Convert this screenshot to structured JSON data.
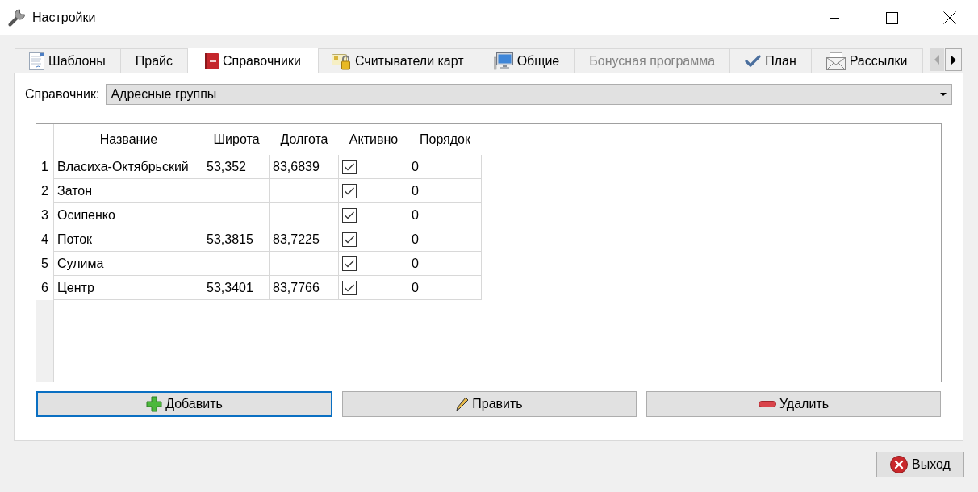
{
  "window": {
    "title": "Настройки"
  },
  "tabs": [
    {
      "label": "Шаблоны",
      "selected": false,
      "disabled": false
    },
    {
      "label": "Прайс",
      "selected": false,
      "disabled": false
    },
    {
      "label": "Справочники",
      "selected": true,
      "disabled": false
    },
    {
      "label": "Считыватели карт",
      "selected": false,
      "disabled": false
    },
    {
      "label": "Общие",
      "selected": false,
      "disabled": false
    },
    {
      "label": "Бонусная программа",
      "selected": false,
      "disabled": true
    },
    {
      "label": "План",
      "selected": false,
      "disabled": false
    },
    {
      "label": "Рассылки",
      "selected": false,
      "disabled": false
    }
  ],
  "tab_scroll": {
    "back_disabled": true,
    "forward_disabled": false
  },
  "reference": {
    "label": "Справочник:",
    "value": "Адресные группы"
  },
  "table": {
    "columns": [
      "Название",
      "Широта",
      "Долгота",
      "Активно",
      "Порядок"
    ],
    "rows": [
      {
        "number": "1",
        "name": "Власиха-Октябрьский",
        "latitude": "53,352",
        "longitude": "83,6839",
        "checked": true,
        "order": "0"
      },
      {
        "number": "2",
        "name": "Затон",
        "checked": true,
        "order": "0"
      },
      {
        "number": "3",
        "name": "Осипенко",
        "checked": true,
        "order": "0"
      },
      {
        "number": "4",
        "name": "Поток",
        "latitude": "53,3815",
        "longitude": "83,7225",
        "checked": true,
        "order": "0"
      },
      {
        "number": "5",
        "name": "Сулима",
        "checked": true,
        "order": "0"
      },
      {
        "number": "6",
        "name": "Центр",
        "latitude": "53,3401",
        "longitude": "83,7766",
        "checked": true,
        "order": "0"
      }
    ]
  },
  "buttons": [
    {
      "label": "Добавить",
      "focused": true
    },
    {
      "label": "Править",
      "focused": false
    },
    {
      "label": "Удалить",
      "focused": false
    }
  ],
  "exit_button": {
    "label": "Выход"
  }
}
